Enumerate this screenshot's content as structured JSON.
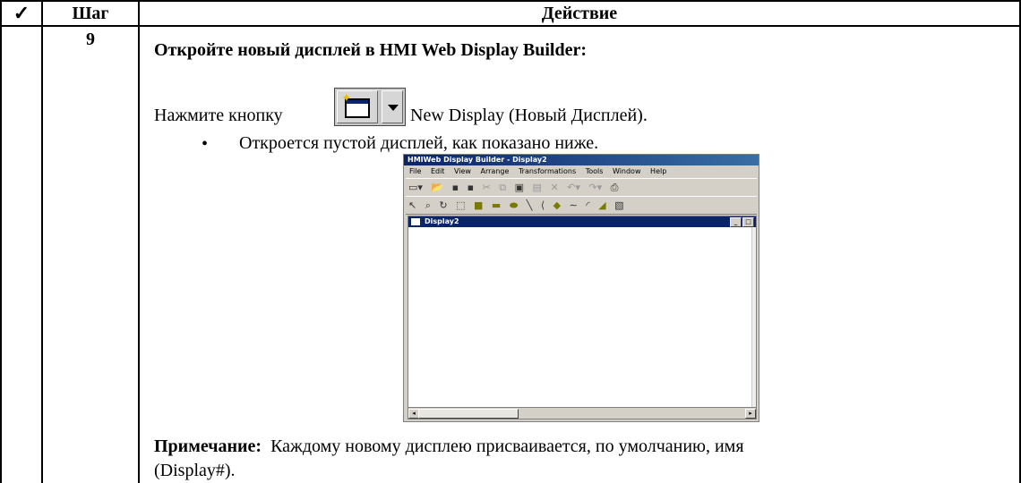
{
  "table": {
    "header": {
      "check": "✓",
      "step": "Шаг",
      "action": "Действие"
    },
    "row": {
      "step_number": "9",
      "title": "Откройте новый дисплей в HMI Web Display Builder:",
      "instruction_before": "Нажмите кнопку",
      "instruction_after": "New Display (Новый Дисплей).",
      "bullet": "Откроется пустой дисплей, как показано ниже.",
      "note_label": "Примечание:",
      "note_text": "Каждому новому дисплею присваивается, по умолчанию, имя",
      "note_text_cont": "(Display#)."
    }
  },
  "button_image": {
    "icon": "new-display-icon",
    "dropdown_icon": "chevron-down-icon"
  },
  "app": {
    "title": "HMIWeb Display Builder - Display2",
    "menu": [
      "File",
      "Edit",
      "View",
      "Arrange",
      "Transformations",
      "Tools",
      "Window",
      "Help"
    ],
    "document_title": "Display2",
    "colors": {
      "titlebar": "#0a246a",
      "chrome": "#d4d0c8"
    }
  }
}
